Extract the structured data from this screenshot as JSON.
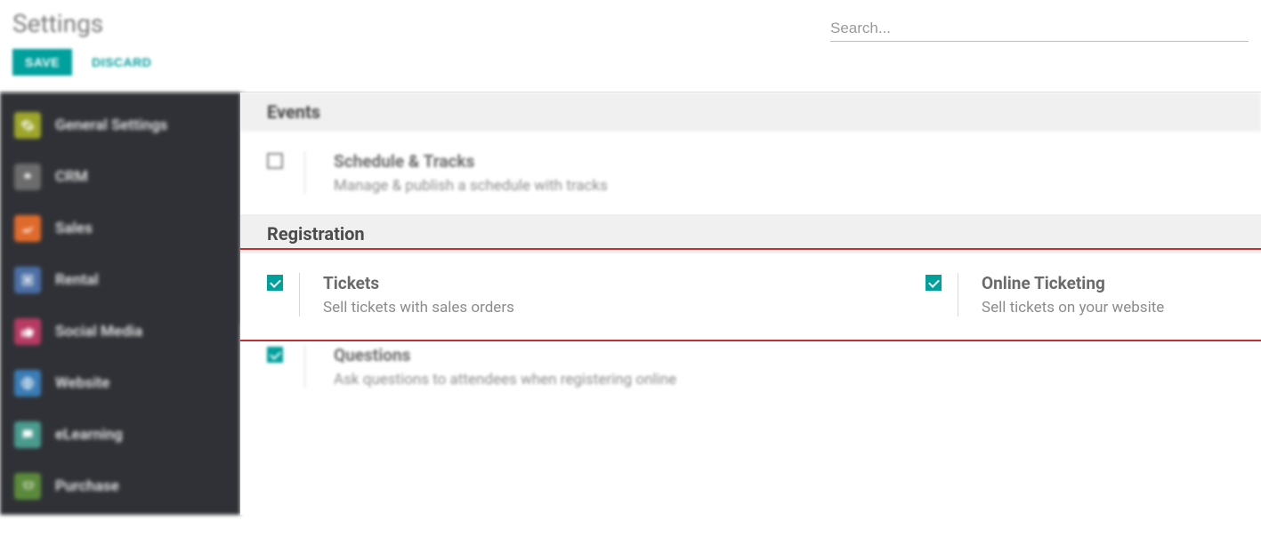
{
  "header": {
    "title": "Settings",
    "search_placeholder": "Search..."
  },
  "actions": {
    "save": "SAVE",
    "discard": "DISCARD"
  },
  "sidebar": {
    "items": [
      {
        "label": "General Settings"
      },
      {
        "label": "CRM"
      },
      {
        "label": "Sales"
      },
      {
        "label": "Rental"
      },
      {
        "label": "Social Media"
      },
      {
        "label": "Website"
      },
      {
        "label": "eLearning"
      },
      {
        "label": "Purchase"
      }
    ]
  },
  "sections": {
    "events": {
      "title": "Events",
      "schedule": {
        "title": "Schedule & Tracks",
        "desc": "Manage & publish a schedule with tracks",
        "checked": false
      }
    },
    "registration": {
      "title": "Registration",
      "tickets": {
        "title": "Tickets",
        "desc": "Sell tickets with sales orders",
        "checked": true
      },
      "online": {
        "title": "Online Ticketing",
        "desc": "Sell tickets on your website",
        "checked": true
      },
      "questions": {
        "title": "Questions",
        "desc": "Ask questions to attendees when registering online",
        "checked": true
      }
    }
  },
  "highlight_color": "#c53030"
}
